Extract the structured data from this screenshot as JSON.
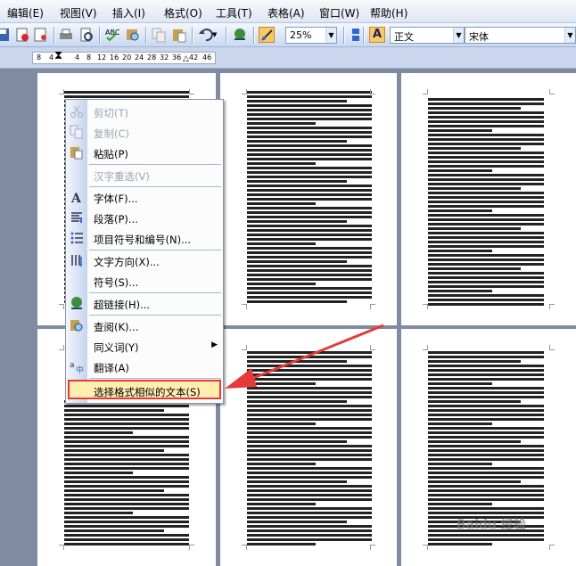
{
  "menubar": {
    "items": [
      {
        "label": "编辑(E)"
      },
      {
        "label": "视图(V)"
      },
      {
        "label": "插入(I)"
      },
      {
        "label": "格式(O)"
      },
      {
        "label": "工具(T)"
      },
      {
        "label": "表格(A)"
      },
      {
        "label": "窗口(W)"
      },
      {
        "label": "帮助(H)"
      }
    ]
  },
  "toolbar": {
    "zoom": "25%",
    "style": "正文",
    "font": "宋体",
    "style_icon_letter": "A"
  },
  "ruler": {
    "numbers": [
      "8",
      "4",
      "4",
      "8",
      "12",
      "16",
      "20",
      "24",
      "28",
      "32",
      "36",
      "42",
      "46"
    ]
  },
  "context_menu": {
    "items": [
      {
        "label": "剪切(T)",
        "icon": "scissors-icon",
        "enabled": false
      },
      {
        "label": "复制(C)",
        "icon": "copy-icon",
        "enabled": false
      },
      {
        "label": "粘贴(P)",
        "icon": "paste-icon",
        "enabled": true
      },
      {
        "label": "汉字重选(V)",
        "icon": "",
        "enabled": false
      },
      {
        "label": "字体(F)...",
        "icon": "font-icon",
        "enabled": true
      },
      {
        "label": "段落(P)...",
        "icon": "paragraph-icon",
        "enabled": true
      },
      {
        "label": "项目符号和编号(N)...",
        "icon": "bullets-icon",
        "enabled": true
      },
      {
        "label": "文字方向(X)...",
        "icon": "text-direction-icon",
        "enabled": true
      },
      {
        "label": "符号(S)...",
        "icon": "",
        "enabled": true
      },
      {
        "label": "超链接(H)...",
        "icon": "hyperlink-icon",
        "enabled": true
      },
      {
        "label": "查阅(K)...",
        "icon": "research-icon",
        "enabled": true
      },
      {
        "label": "同义词(Y)",
        "icon": "",
        "enabled": true,
        "submenu": true
      },
      {
        "label": "翻译(A)",
        "icon": "translate-icon",
        "enabled": true
      },
      {
        "label": "选择格式相似的文本(S)",
        "icon": "",
        "enabled": true,
        "highlighted": true
      }
    ]
  },
  "watermark": "Baidu 经验",
  "colors": {
    "highlight_border": "#e53a3a",
    "arrow": "#e53a3a",
    "workspace": "#7f8ba0"
  }
}
